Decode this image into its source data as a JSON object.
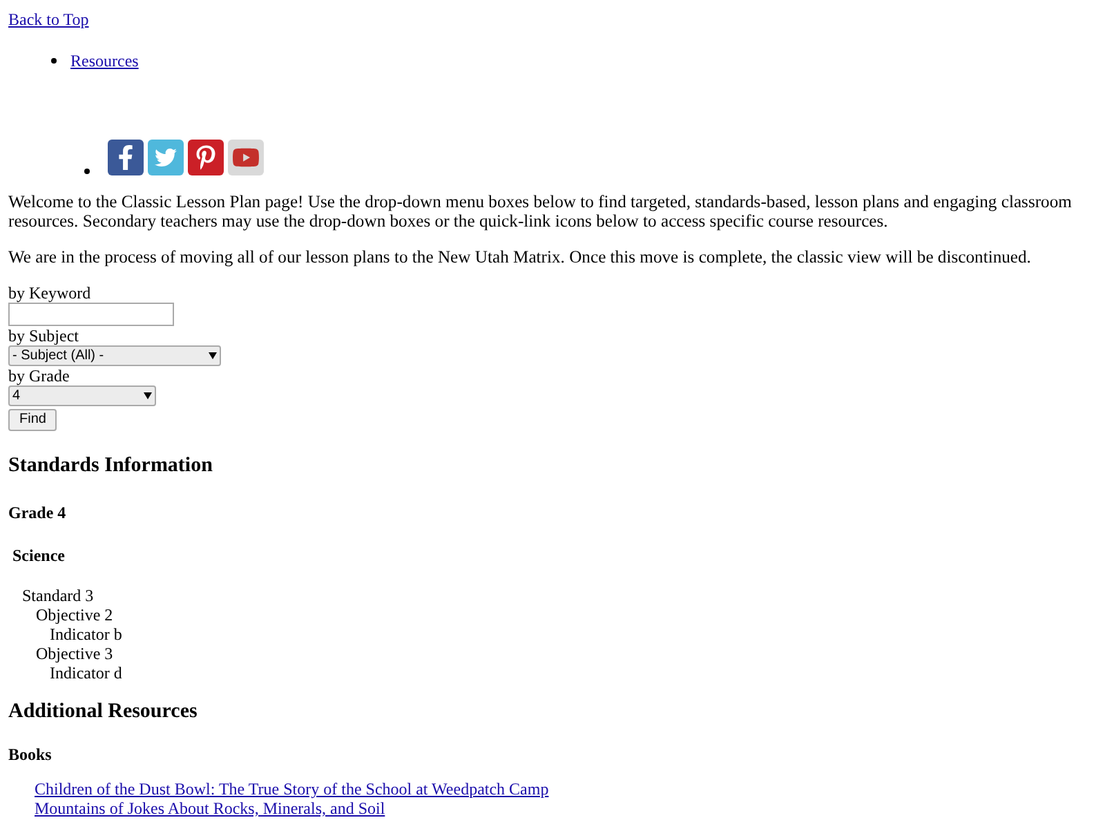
{
  "top_link": "Back to Top",
  "nav_items": [
    "Resources"
  ],
  "social_icons": [
    {
      "kind": "facebook",
      "color": "#3b5998"
    },
    {
      "kind": "twitter",
      "color": "#4fb8dc"
    },
    {
      "kind": "pinterest",
      "color": "#cb2027"
    },
    {
      "kind": "youtube",
      "color": "#d9d9d9"
    }
  ],
  "intro": [
    "Welcome to the Classic Lesson Plan page! Use the drop-down menu boxes below to find targeted, standards-based, lesson plans and engaging classroom resources. Secondary teachers may use the drop-down boxes or the quick-link icons below to access specific course resources.",
    "We are in the process of moving all of our lesson plans to the New Utah Matrix. Once this move is complete, the classic view will be discontinued."
  ],
  "search": {
    "keyword_label": "by Keyword",
    "subject_label": "by Subject",
    "subject_value": "- Subject (All) -",
    "grade_label": "by Grade",
    "grade_value": "4",
    "button": "Find"
  },
  "standards": {
    "title": "Standards Information",
    "grade": "Grade 4",
    "subject": "Science",
    "tree": [
      {
        "label": "Standard 3",
        "children": [
          {
            "label": "Objective 2",
            "children": [
              {
                "label": "Indicator b"
              }
            ]
          },
          {
            "label": "Objective 3",
            "children": [
              {
                "label": "Indicator d"
              }
            ]
          }
        ]
      }
    ]
  },
  "resources": {
    "title": "Additional Resources",
    "section": "Books",
    "links": [
      "Children of the Dust Bowl: The True Story of the School at Weedpatch Camp",
      "Mountains of Jokes About Rocks, Minerals, and Soil"
    ]
  }
}
